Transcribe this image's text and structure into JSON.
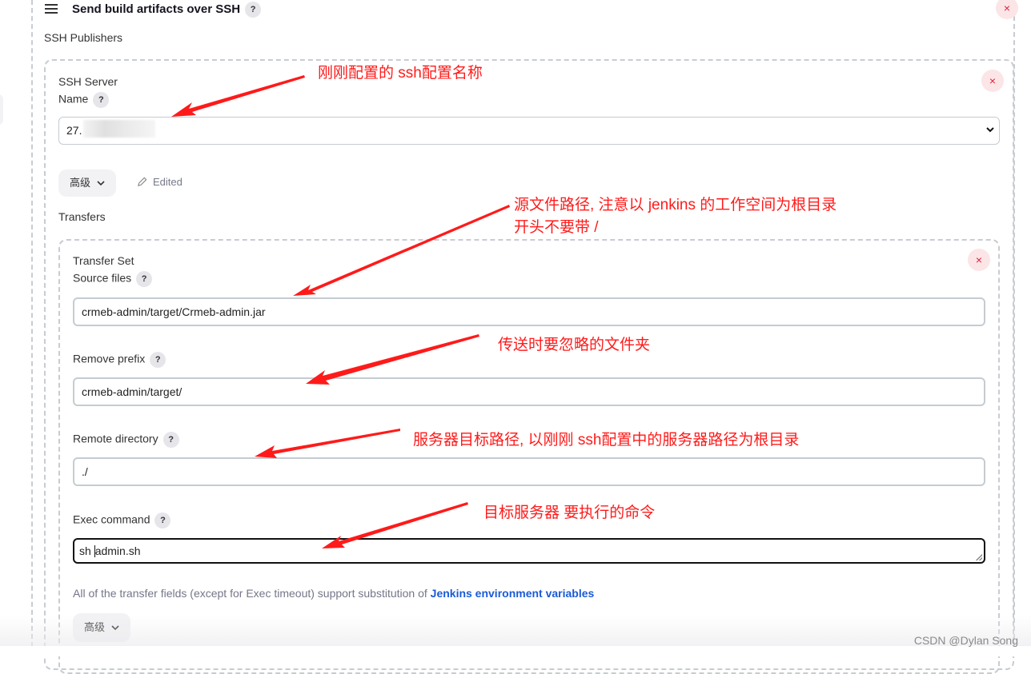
{
  "section": {
    "title": "Send build artifacts over SSH",
    "subtitle": "SSH Publishers"
  },
  "ssh_server": {
    "heading": "SSH Server",
    "name_label": "Name",
    "name_value": "27.",
    "advanced_label": "高级",
    "edited_label": "Edited",
    "transfers_label": "Transfers"
  },
  "transfer_set": {
    "heading": "Transfer Set",
    "source_files_label": "Source files",
    "source_files_value": "crmeb-admin/target/Crmeb-admin.jar",
    "remove_prefix_label": "Remove prefix",
    "remove_prefix_value": "crmeb-admin/target/",
    "remote_directory_label": "Remote directory",
    "remote_directory_value": "./",
    "exec_command_label": "Exec command",
    "exec_command_before_caret": "sh ",
    "exec_command_after_caret": "admin.sh",
    "hint_text": "All of the transfer fields (except for Exec timeout) support substitution of ",
    "hint_link": "Jenkins environment variables",
    "advanced_label": "高级"
  },
  "icons": {
    "help": "?",
    "close": "×",
    "chevron": "⌄"
  },
  "annotations": {
    "ssh_name": "刚刚配置的 ssh配置名称",
    "source_line1": "源文件路径, 注意以 jenkins 的工作空间为根目录",
    "source_line2": "开头不要带 /",
    "remove_prefix": "传送时要忽略的文件夹",
    "remote_dir": "服务器目标路径, 以刚刚 ssh配置中的服务器路径为根目录",
    "exec": "目标服务器 要执行的命令"
  },
  "colors": {
    "annotation": "#ff1a1a",
    "link": "#1a5bd6",
    "close": "#e0213a"
  },
  "watermark": "CSDN @Dylan  Song"
}
